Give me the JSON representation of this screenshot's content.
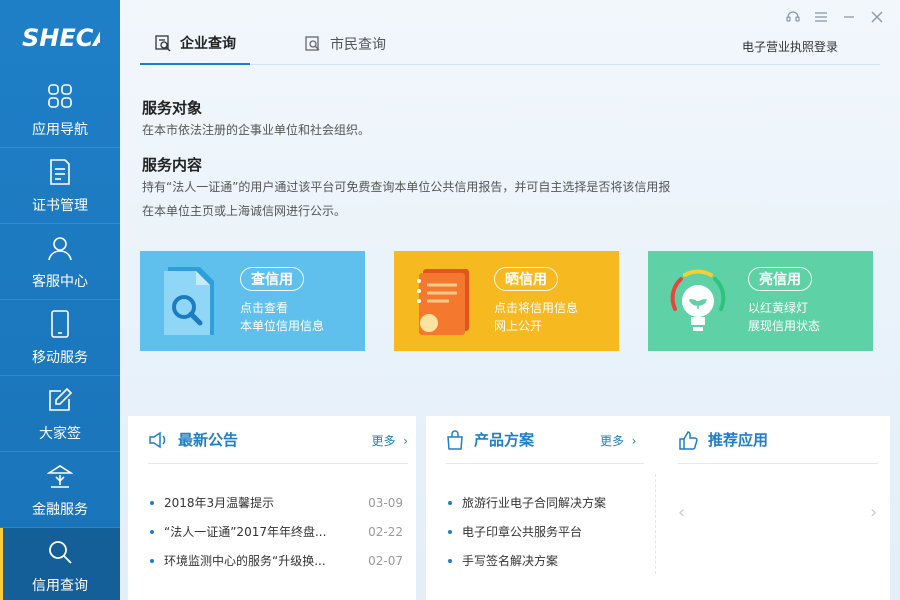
{
  "app": {
    "logo_text": "SHECA"
  },
  "sidebar": {
    "items": [
      {
        "label": "应用导航",
        "icon": "grid-icon"
      },
      {
        "label": "证书管理",
        "icon": "document-icon"
      },
      {
        "label": "客服中心",
        "icon": "user-icon"
      },
      {
        "label": "移动服务",
        "icon": "phone-icon"
      },
      {
        "label": "大家签",
        "icon": "pen-icon"
      },
      {
        "label": "金融服务",
        "icon": "bank-icon"
      },
      {
        "label": "信用查询",
        "icon": "search-icon",
        "active": true
      }
    ]
  },
  "tabs": [
    {
      "label": "企业查询",
      "active": true
    },
    {
      "label": "市民查询",
      "active": false
    }
  ],
  "header": {
    "license_login": "电子营业执照登录"
  },
  "service": {
    "target_title": "服务对象",
    "target_text": "在本市依法注册的企事业单位和社会组织。",
    "content_title": "服务内容",
    "content_line1": "持有“法人一证通”的用户通过该平台可免费查询本单位公共信用报告，并可自主选择是否将该信用报",
    "content_line2": "在本单位主页或上海诚信网进行公示。"
  },
  "cards": [
    {
      "pill": "查信用",
      "line1": "点击查看",
      "line2": "本单位信用信息",
      "color": "#5fc0ee"
    },
    {
      "pill": "晒信用",
      "line1": "点击将信用信息",
      "line2": "网上公开",
      "color": "#f6b91f"
    },
    {
      "pill": "亮信用",
      "line1": "以红黄绿灯",
      "line2": "展现信用状态",
      "color": "#5fd1a7"
    }
  ],
  "news": {
    "title": "最新公告",
    "more": "更多",
    "items": [
      {
        "text": "2018年3月温馨提示",
        "date": "03-09"
      },
      {
        "text": "“法人一证通”2017年年终盘...",
        "date": "02-22"
      },
      {
        "text": "环境监测中心的服务“升级换...",
        "date": "02-07"
      }
    ]
  },
  "products": {
    "title": "产品方案",
    "more": "更多",
    "items": [
      "旅游行业电子合同解决方案",
      "电子印章公共服务平台",
      "手写签名解决方案"
    ]
  },
  "recommend": {
    "title": "推荐应用"
  },
  "colors": {
    "primary": "#1e7fc7",
    "sidebar": "#1a73b8"
  }
}
